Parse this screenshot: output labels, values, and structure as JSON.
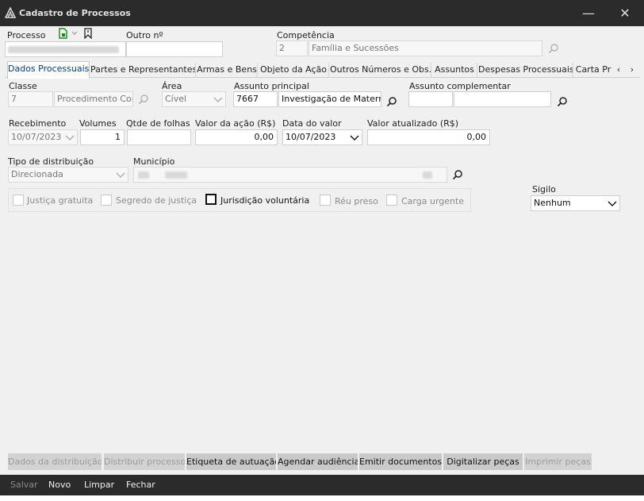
{
  "window": {
    "title": "Cadastro de Processos",
    "minimize_glyph": "—",
    "close_glyph": "✕"
  },
  "header": {
    "processo_label": "Processo",
    "outro_label": "Outro nº",
    "outro_value": "",
    "competencia_label": "Competência",
    "competencia_code": "2",
    "competencia_desc": "Família e Sucessões"
  },
  "tabs": [
    {
      "label": "Dados Processuais",
      "active": true
    },
    {
      "label": "Partes e Representantes"
    },
    {
      "label": "Armas e Bens"
    },
    {
      "label": "Objeto da Ação"
    },
    {
      "label": "Outros Números e Obs."
    },
    {
      "label": "Assuntos"
    },
    {
      "label": "Despesas Processuais"
    },
    {
      "label": "Carta Pr"
    }
  ],
  "tab_scroll": {
    "left": "‹",
    "right": "›"
  },
  "form": {
    "classe_label": "Classe",
    "classe_code": "7",
    "classe_desc": "Procedimento Com",
    "area_label": "Área",
    "area_value": "Cível",
    "assunto_principal_label": "Assunto principal",
    "assunto_principal_code": "7667",
    "assunto_principal_desc": "Investigação de Maternic",
    "assunto_comp_label": "Assunto complementar",
    "assunto_comp_code": "",
    "assunto_comp_desc": "",
    "recebimento_label": "Recebimento",
    "recebimento_value": "10/07/2023",
    "volumes_label": "Volumes",
    "volumes_value": "1",
    "folhas_label": "Qtde de folhas",
    "folhas_value": "",
    "valor_acao_label": "Valor da ação (R$)",
    "valor_acao_value": "0,00",
    "data_valor_label": "Data do valor",
    "data_valor_value": "10/07/2023",
    "valor_atual_label": "Valor atualizado (R$)",
    "valor_atual_value": "0,00",
    "tipo_dist_label": "Tipo de distribuição",
    "tipo_dist_value": "Direcionada",
    "municipio_label": "Município",
    "sigilo_label": "Sigilo",
    "sigilo_value": "Nenhum"
  },
  "checkboxes": [
    {
      "label": "Justiça gratuita",
      "checked": false,
      "enabled": false
    },
    {
      "label": "Segredo de justiça",
      "checked": false,
      "enabled": false
    },
    {
      "label": "Jurisdição voluntária",
      "checked": false,
      "enabled": true
    },
    {
      "label": "Réu preso",
      "checked": false,
      "enabled": false
    },
    {
      "label": "Carga urgente",
      "checked": false,
      "enabled": false
    }
  ],
  "actions": [
    {
      "label": "Dados da distribuição",
      "enabled": false
    },
    {
      "label": "Distribuir processo",
      "enabled": false
    },
    {
      "label": "Etiqueta de autuação",
      "enabled": true
    },
    {
      "label": "Agendar audiência",
      "enabled": true
    },
    {
      "label": "Emitir documentos",
      "enabled": true
    },
    {
      "label": "Digitalizar peças",
      "enabled": true
    },
    {
      "label": "Imprimir peças",
      "enabled": false
    }
  ],
  "footer": {
    "salvar": "Salvar",
    "novo": "Novo",
    "limpar": "Limpar",
    "fechar": "Fechar"
  },
  "colors": {
    "titlebar": "#2b2b2b",
    "active_tab_text": "#003c7d",
    "button_bg": "#c9c9c9"
  },
  "icons": [
    "app-logo-icon",
    "document-new-icon",
    "chevron-down-icon",
    "bookmark-icon",
    "search-icon",
    "dropdown-arrow-icon",
    "minimize-icon",
    "close-icon"
  ]
}
